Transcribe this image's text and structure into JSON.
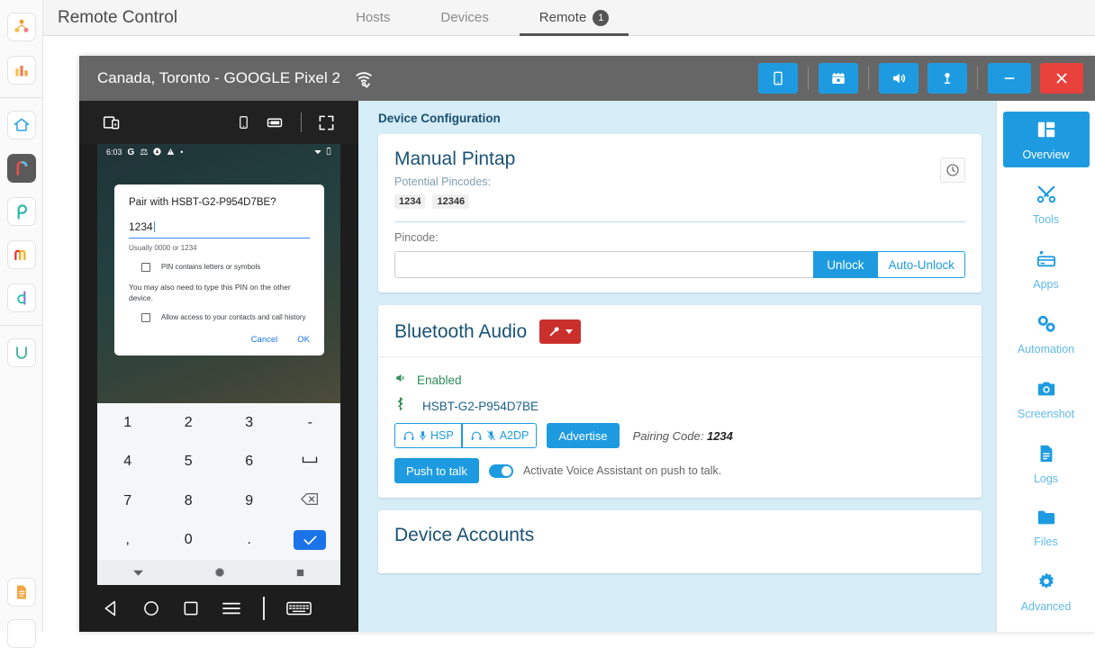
{
  "app_rail": {
    "items": [
      {
        "name": "org-chart-app-icon",
        "label": "Org Chart",
        "active": false
      },
      {
        "name": "analytics-app-icon",
        "label": "Analytics",
        "active": false
      },
      {
        "name": "home-app-icon",
        "label": "Home",
        "active": false
      },
      {
        "name": "remote-app-icon",
        "label": "Remote",
        "active": true
      },
      {
        "name": "pulse-app-icon",
        "label": "Pulse",
        "active": false
      },
      {
        "name": "monitor-app-icon",
        "label": "Monitor",
        "active": false
      },
      {
        "name": "data-app-icon",
        "label": "Data",
        "active": false
      },
      {
        "name": "uplink-app-icon",
        "label": "Uplink",
        "active": false
      },
      {
        "name": "docs-app-icon",
        "label": "Docs",
        "active": false
      }
    ]
  },
  "topbar": {
    "title": "Remote Control",
    "tabs": [
      {
        "label": "Hosts",
        "badge": "",
        "active": false
      },
      {
        "label": "Devices",
        "badge": "",
        "active": false
      },
      {
        "label": "Remote",
        "badge": "1",
        "active": true
      }
    ]
  },
  "device_window": {
    "title": "Canada, Toronto - GOOGLE Pixel 2",
    "wifi_icon": "wifi-check-icon",
    "titlebar_buttons": [
      {
        "name": "phone-view-button",
        "icon": "phone-icon"
      },
      {
        "name": "record-video-button",
        "icon": "clapperboard-icon"
      },
      {
        "name": "speaker-button",
        "icon": "speaker-icon"
      },
      {
        "name": "microphone-button",
        "icon": "microphone-icon"
      },
      {
        "name": "minimize-button",
        "icon": "minimize-icon"
      },
      {
        "name": "close-button",
        "icon": "close-icon"
      }
    ]
  },
  "device_toolbar": {
    "screens_icon": "multi-screen-icon",
    "portrait_icon": "portrait-phone-icon",
    "landscape_icon": "landscape-phone-icon",
    "fullscreen_icon": "fullscreen-icon"
  },
  "android": {
    "status_bar": {
      "time": "6:03",
      "icons": [
        "google-icon",
        "bluetooth-icon",
        "navigation-icon",
        "warning-icon",
        "dot-icon"
      ],
      "right_icons": [
        "wifi-icon",
        "battery-icon"
      ]
    },
    "pair_dialog": {
      "title": "Pair with HSBT-G2-P954D7BE?",
      "pin_value": "1234",
      "hint": "Usually 0000 or 1234",
      "checkbox_1": "PIN contains letters or symbols",
      "paragraph": "You may also need to type this PIN on the other device.",
      "checkbox_2": "Allow access to your contacts and call history",
      "cancel_label": "Cancel",
      "ok_label": "OK"
    },
    "keypad": [
      "1",
      "2",
      "3",
      "-",
      "4",
      "5",
      "6",
      "space",
      "7",
      "8",
      "9",
      "backspace",
      ",",
      "0",
      ".",
      "ok"
    ],
    "keyboard_nav": [
      "collapse-icon",
      "circle-icon",
      "square-icon"
    ],
    "bottom_nav": [
      "back-icon",
      "home-icon",
      "recents-icon",
      "menu-icon",
      "keyboard-icon"
    ]
  },
  "config": {
    "section_title": "Device Configuration",
    "manual_pintap": {
      "heading": "Manual Pintap",
      "pincodes_label": "Potential Pincodes:",
      "pincodes": [
        "1234",
        "12346"
      ],
      "history_icon": "clock-history-icon",
      "pincode_label": "Pincode:",
      "pincode_value": "",
      "pincode_placeholder": "",
      "unlock_label": "Unlock",
      "auto_unlock_label": "Auto-Unlock"
    },
    "bluetooth_audio": {
      "heading": "Bluetooth Audio",
      "tool_icon": "wrench-icon",
      "enabled_label": "Enabled",
      "enabled_icon": "volume-icon",
      "device_name": "HSBT-G2-P954D7BE",
      "device_icon": "bluetooth-icon",
      "hsp_label": "HSP",
      "hsp_icons": [
        "headset-icon",
        "microphone-icon"
      ],
      "a2dp_label": "A2DP",
      "a2dp_icons": [
        "headphones-icon",
        "microphone-muted-icon"
      ],
      "advertise_label": "Advertise",
      "pairing_code_label": "Pairing Code:",
      "pairing_code_value": "1234",
      "push_to_talk_label": "Push to talk",
      "voice_assistant_label": "Activate Voice Assistant on push to talk.",
      "voice_assistant_on": true
    },
    "device_accounts": {
      "heading": "Device Accounts"
    }
  },
  "right_nav": {
    "items": [
      {
        "label": "Overview",
        "icon": "dashboard-icon",
        "active": true
      },
      {
        "label": "Tools",
        "icon": "tools-icon",
        "active": false
      },
      {
        "label": "Apps",
        "icon": "apps-card-icon",
        "active": false
      },
      {
        "label": "Automation",
        "icon": "gears-icon",
        "active": false
      },
      {
        "label": "Screenshot",
        "icon": "camera-icon",
        "active": false
      },
      {
        "label": "Logs",
        "icon": "document-icon",
        "active": false
      },
      {
        "label": "Files",
        "icon": "folder-icon",
        "active": false
      },
      {
        "label": "Advanced",
        "icon": "gear-icon",
        "active": false
      }
    ]
  },
  "colors": {
    "accent_blue": "#1e9be0",
    "danger_red": "#c9302c",
    "panel_blue": "#d6ecf7",
    "heading_blue": "#1a5276",
    "success_green": "#2e8b57"
  }
}
